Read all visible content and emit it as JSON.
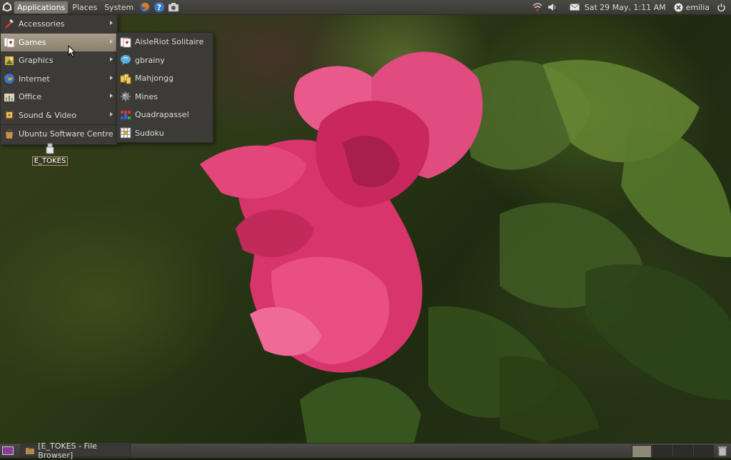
{
  "top_panel": {
    "menus": [
      "Applications",
      "Places",
      "System"
    ],
    "active_menu": "Applications",
    "clock": "Sat 29 May,  1:11 AM",
    "user": "emilia",
    "launcher_icons": [
      "firefox-icon",
      "help-icon",
      "screenshot-icon"
    ],
    "indicators": [
      "network-icon",
      "volume-icon",
      "mail-icon"
    ]
  },
  "applications_menu": {
    "items": [
      {
        "label": "Accessories",
        "icon": "accessories-icon",
        "submenu": true
      },
      {
        "label": "Games",
        "icon": "games-icon",
        "submenu": true,
        "highlighted": true
      },
      {
        "label": "Graphics",
        "icon": "graphics-icon",
        "submenu": true
      },
      {
        "label": "Internet",
        "icon": "internet-icon",
        "submenu": true
      },
      {
        "label": "Office",
        "icon": "office-icon",
        "submenu": true
      },
      {
        "label": "Sound & Video",
        "icon": "sound-video-icon",
        "submenu": true
      },
      {
        "label": "Ubuntu Software Centre",
        "icon": "software-centre-icon",
        "submenu": false
      }
    ]
  },
  "games_menu": {
    "items": [
      {
        "label": "AisleRiot Solitaire",
        "icon": "solitaire-icon"
      },
      {
        "label": "gbrainy",
        "icon": "gbrainy-icon"
      },
      {
        "label": "Mahjongg",
        "icon": "mahjongg-icon"
      },
      {
        "label": "Mines",
        "icon": "mines-icon"
      },
      {
        "label": "Quadrapassel",
        "icon": "quadrapassel-icon"
      },
      {
        "label": "Sudoku",
        "icon": "sudoku-icon"
      }
    ]
  },
  "desktop": {
    "icons": [
      {
        "label": "E_TOKES",
        "icon": "usb-drive-icon"
      }
    ]
  },
  "bottom_panel": {
    "task": "[E_TOKES - File Browser]",
    "workspaces": 4,
    "active_workspace": 1
  }
}
